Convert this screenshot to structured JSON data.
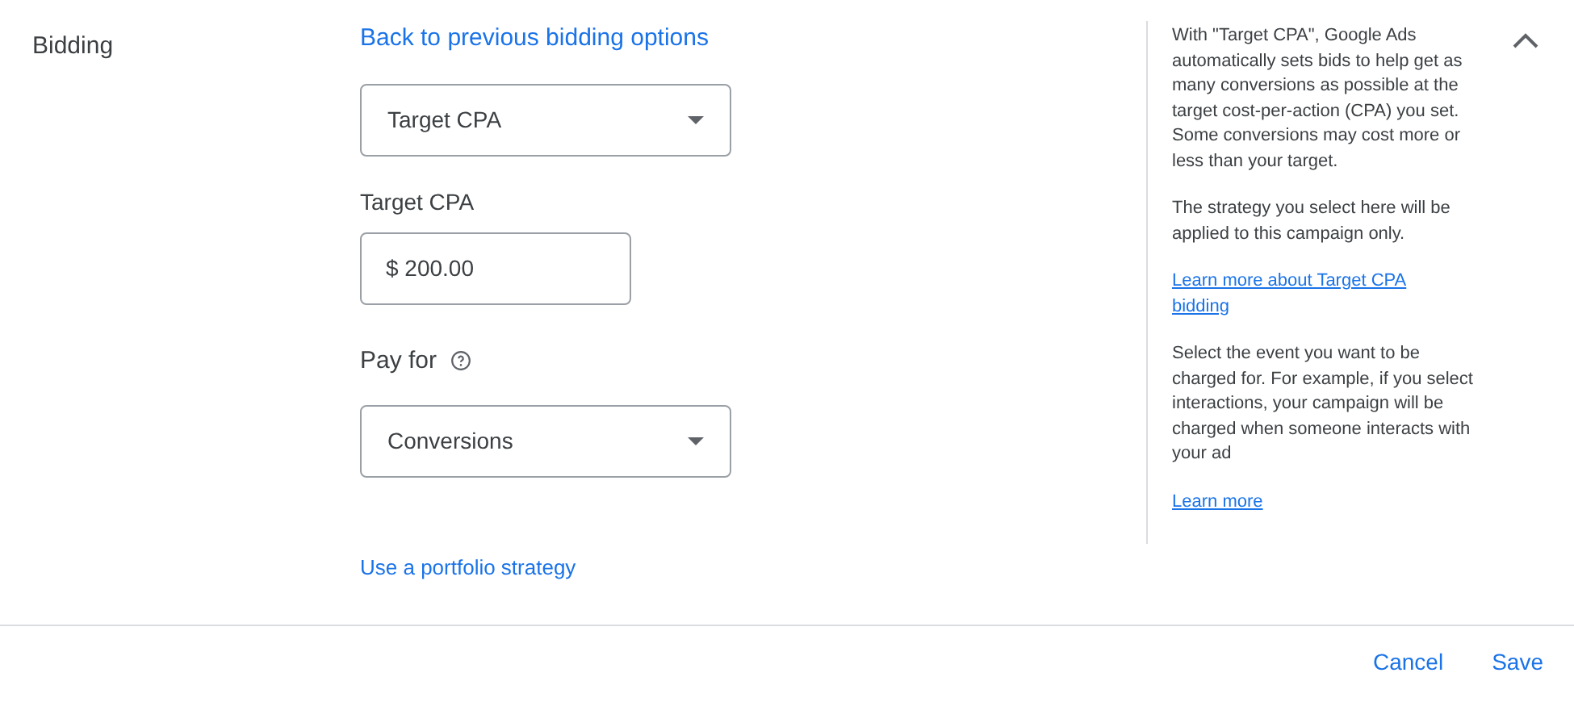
{
  "section": {
    "title": "Bidding",
    "expanded": true
  },
  "form": {
    "back_link": "Back to previous bidding options",
    "strategy_select": {
      "value": "Target CPA"
    },
    "target_cpa": {
      "label": "Target CPA",
      "value": "$ 200.00"
    },
    "pay_for": {
      "label": "Pay for",
      "select": {
        "value": "Conversions"
      }
    },
    "portfolio_link": "Use a portfolio strategy"
  },
  "help": [
    {
      "kind": "text",
      "text": "With \"Target CPA\", Google Ads automatically sets bids to help get as many conversions as possible at the target cost-per-action (CPA) you set. Some conversions may cost more or less than your target."
    },
    {
      "kind": "text",
      "text": "The strategy you select here will be applied to this campaign only."
    },
    {
      "kind": "link",
      "text": "Learn more about Target CPA bidding"
    },
    {
      "kind": "text",
      "text": "Select the event you want to be charged for. For example, if you select interactions, your campaign will be charged when someone interacts with your ad"
    },
    {
      "kind": "link",
      "text": "Learn more"
    }
  ],
  "footer": {
    "buttons": [
      "Cancel",
      "Save"
    ]
  }
}
